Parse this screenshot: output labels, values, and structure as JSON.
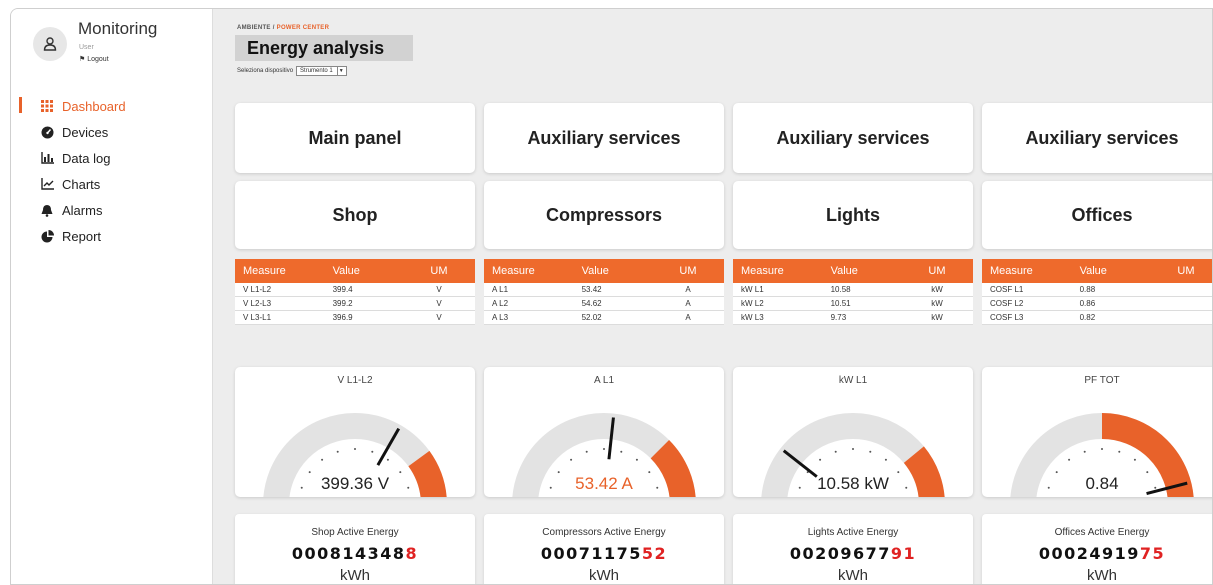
{
  "sidebar": {
    "app_title": "Monitoring",
    "user_label": "User",
    "logout_label": "Logout",
    "items": [
      {
        "label": "Dashboard",
        "icon": "grid-icon",
        "active": true
      },
      {
        "label": "Devices",
        "icon": "gauge-icon"
      },
      {
        "label": "Data log",
        "icon": "bar-chart-icon"
      },
      {
        "label": "Charts",
        "icon": "line-chart-icon"
      },
      {
        "label": "Alarms",
        "icon": "bell-icon"
      },
      {
        "label": "Report",
        "icon": "pie-chart-icon"
      }
    ]
  },
  "header": {
    "breadcrumb_root": "AMBIENTE",
    "breadcrumb_sep": "/",
    "breadcrumb_current": "POWER CENTER",
    "title": "Energy analysis",
    "device_label": "Seleziona dispositivo",
    "device_value": "Strumento 1"
  },
  "panels": [
    {
      "group": "Main panel",
      "name": "Shop"
    },
    {
      "group": "Auxiliary services",
      "name": "Compressors"
    },
    {
      "group": "Auxiliary services",
      "name": "Lights"
    },
    {
      "group": "Auxiliary services",
      "name": "Offices"
    }
  ],
  "tables": [
    {
      "headers": [
        "Measure",
        "Value",
        "UM"
      ],
      "rows": [
        [
          "V L1-L2",
          "399.4",
          "V"
        ],
        [
          "V L2-L3",
          "399.2",
          "V"
        ],
        [
          "V L3-L1",
          "396.9",
          "V"
        ]
      ]
    },
    {
      "headers": [
        "Measure",
        "Value",
        "UM"
      ],
      "rows": [
        [
          "A L1",
          "53.42",
          "A"
        ],
        [
          "A L2",
          "54.62",
          "A"
        ],
        [
          "A L3",
          "52.02",
          "A"
        ]
      ]
    },
    {
      "headers": [
        "Measure",
        "Value",
        "UM"
      ],
      "rows": [
        [
          "kW L1",
          "10.58",
          "kW"
        ],
        [
          "kW L2",
          "10.51",
          "kW"
        ],
        [
          "kW L3",
          "9.73",
          "kW"
        ]
      ]
    },
    {
      "headers": [
        "Measure",
        "Value",
        "UM"
      ],
      "rows": [
        [
          "COSF L1",
          "0.88",
          ""
        ],
        [
          "COSF L2",
          "0.86",
          ""
        ],
        [
          "COSF L3",
          "0.82",
          ""
        ]
      ]
    }
  ],
  "gauges": [
    {
      "label": "V L1-L2",
      "display": "399.36 V",
      "value": 399.36,
      "min": 0,
      "max": 600,
      "red_from": 0.8,
      "value_color": "#222222"
    },
    {
      "label": "A L1",
      "display": "53.42 A",
      "value": 53.42,
      "min": 0,
      "max": 100,
      "red_from": 0.75,
      "value_color": "#e8622a"
    },
    {
      "label": "kW L1",
      "display": "10.58 kW",
      "value": 10.58,
      "min": 0,
      "max": 50,
      "red_from": 0.78,
      "value_color": "#222222"
    },
    {
      "label": "PF TOT",
      "display": "0.84",
      "value": 0.84,
      "min": -1,
      "max": 1,
      "red_from": 0.5,
      "value_color": "#222222"
    }
  ],
  "energy": [
    {
      "title": "Shop  Active Energy",
      "digits_main": "000814348",
      "digits_red": "8",
      "unit": "kWh"
    },
    {
      "title": "Compressors  Active Energy",
      "digits_main": "00071175",
      "digits_red": "52",
      "unit": "kWh"
    },
    {
      "title": "Lights  Active Energy",
      "digits_main": "00209677",
      "digits_red": "91",
      "unit": "kWh"
    },
    {
      "title": "Offices  Active Energy",
      "digits_main": "00024919",
      "digits_red": "75",
      "unit": "kWh"
    }
  ],
  "colors": {
    "accent": "#e8622a",
    "table_header": "#ee6a2c",
    "gauge_track": "#e3e3e3",
    "counter_red": "#e02222"
  }
}
